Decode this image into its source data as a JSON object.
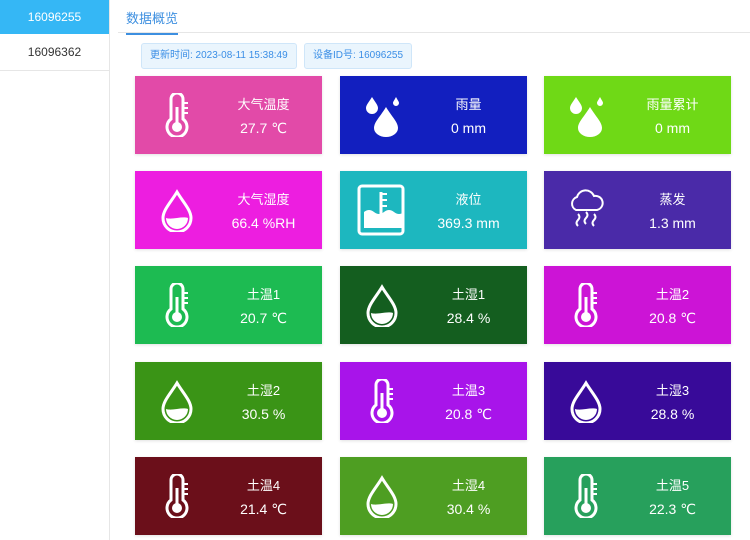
{
  "sidebar": {
    "items": [
      {
        "label": "16096255"
      },
      {
        "label": "16096362"
      }
    ]
  },
  "tabs": [
    {
      "label": "数据概览"
    }
  ],
  "meta": {
    "update_time": "更新时间: 2023-08-11 15:38:49",
    "device_id": "设备ID号: 16096255"
  },
  "cards": [
    {
      "label": "大气温度",
      "value": "27.7 ℃",
      "color": "#e24aa8",
      "icon": "thermometer-icon"
    },
    {
      "label": "雨量",
      "value": "0 mm",
      "color": "#121fbf",
      "icon": "rain-drops-icon"
    },
    {
      "label": "雨量累计",
      "value": "0 mm",
      "color": "#6fd916",
      "icon": "rain-drops-icon"
    },
    {
      "label": "大气湿度",
      "value": "66.4 %RH",
      "color": "#ed1ee0",
      "icon": "drop-icon"
    },
    {
      "label": "液位",
      "value": "369.3 mm",
      "color": "#1db7bf",
      "icon": "water-level-icon"
    },
    {
      "label": "蒸发",
      "value": "1.3 mm",
      "color": "#4a2aa8",
      "icon": "evaporation-icon"
    },
    {
      "label": "土温1",
      "value": "20.7 ℃",
      "color": "#1dbb52",
      "icon": "thermometer-icon"
    },
    {
      "label": "土湿1",
      "value": "28.4 %",
      "color": "#145e1f",
      "icon": "drop-icon"
    },
    {
      "label": "土温2",
      "value": "20.8 ℃",
      "color": "#cc14d6",
      "icon": "thermometer-icon"
    },
    {
      "label": "土湿2",
      "value": "30.5 %",
      "color": "#3a9416",
      "icon": "drop-icon"
    },
    {
      "label": "土温3",
      "value": "20.8 ℃",
      "color": "#a814ea",
      "icon": "thermometer-icon"
    },
    {
      "label": "土湿3",
      "value": "28.8 %",
      "color": "#380a99",
      "icon": "drop-icon"
    },
    {
      "label": "土温4",
      "value": "21.4 ℃",
      "color": "#6b0f1a",
      "icon": "thermometer-icon"
    },
    {
      "label": "土湿4",
      "value": "30.4 %",
      "color": "#4e9e22",
      "icon": "drop-icon"
    },
    {
      "label": "土温5",
      "value": "22.3 ℃",
      "color": "#27a05c",
      "icon": "thermometer-icon"
    }
  ]
}
